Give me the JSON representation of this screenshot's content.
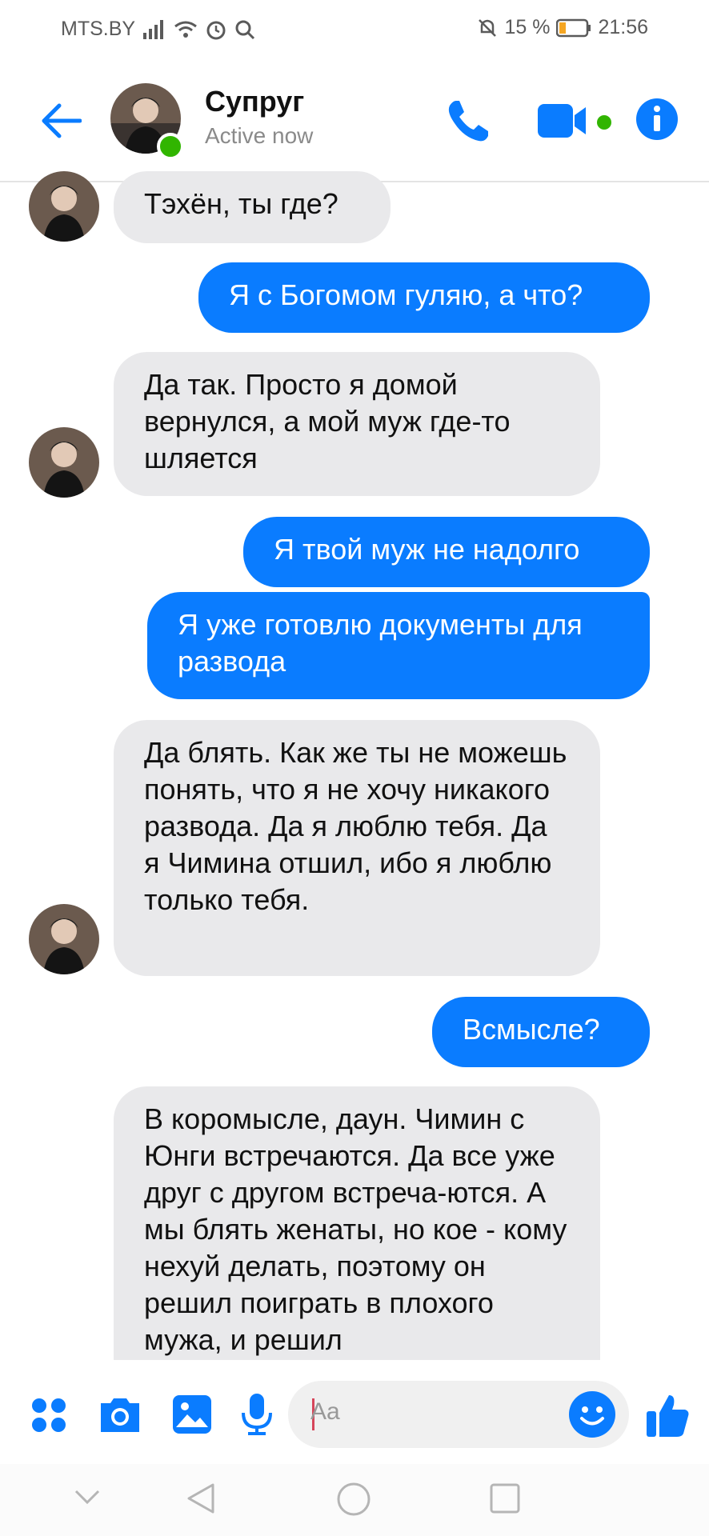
{
  "status_bar": {
    "carrier": "MTS.BY",
    "battery": "15 %",
    "time": "21:56"
  },
  "header": {
    "name": "Супруг",
    "status": "Active now"
  },
  "messages": [
    {
      "dir": "in",
      "text": "Тэхён, ты где?"
    },
    {
      "dir": "out",
      "text": "Я с Богомом гуляю, а что?"
    },
    {
      "dir": "in",
      "text": "Да так. Просто я домой вернулся, а мой муж где-то шляется"
    },
    {
      "dir": "out",
      "text": "Я твой муж не надолго"
    },
    {
      "dir": "out",
      "text": "Я уже готовлю документы для развода"
    },
    {
      "dir": "in",
      "text": "Да блять. Как же ты не можешь понять, что я не хочу никакого развода. Да я люблю тебя. Да я Чимина отшил, ибо я люблю только тебя."
    },
    {
      "dir": "out",
      "text": "Всмысле?"
    },
    {
      "dir": "in",
      "text": "В коромысле, даун. Чимин с Юнги встречаются. Да все уже друг с другом встреча-ются. А мы блять женаты, но кое - кому нехуй делать, поэтому он решил поиграть в плохого мужа, и решил"
    }
  ],
  "composer": {
    "placeholder": "Aa"
  },
  "colors": {
    "accent": "#0a7cff",
    "incoming_bg": "#e9e9eb",
    "online": "#31b500"
  },
  "icons": [
    "back-arrow-icon",
    "phone-icon",
    "video-icon",
    "info-icon",
    "apps-icon",
    "camera-icon",
    "gallery-icon",
    "mic-icon",
    "emoji-icon",
    "like-icon"
  ]
}
